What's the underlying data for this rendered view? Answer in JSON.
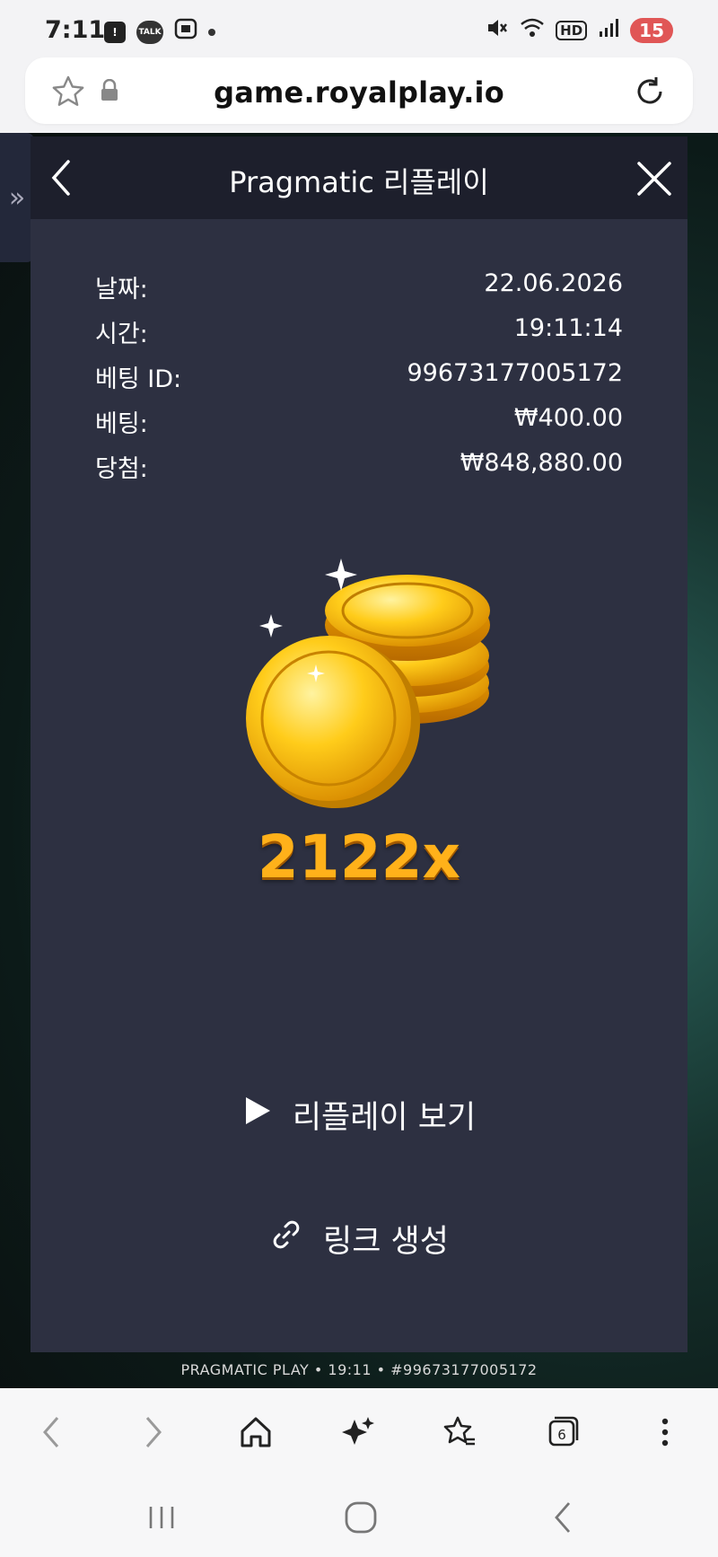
{
  "status_bar": {
    "time": "7:11",
    "battery": "15",
    "icons": [
      "alert-icon",
      "kakaotalk-icon",
      "screenshot-icon",
      "notification-dot-icon",
      "mute-icon",
      "wifi-icon",
      "hd-icon",
      "signal-icon"
    ],
    "talk_label": "TALK",
    "hd_label": "HD"
  },
  "browser": {
    "url": "game.royalplay.io"
  },
  "game": {
    "sidebar_toggle": "»",
    "footer_text": "PRAGMATIC PLAY • 19:11 • #99673177005172"
  },
  "modal": {
    "title": "Pragmatic 리플레이",
    "details": [
      {
        "label": "날짜:",
        "value": "22.06.2026"
      },
      {
        "label": "시간:",
        "value": "19:11:14"
      },
      {
        "label": "베팅 ID:",
        "value": "99673177005172"
      },
      {
        "label": "베팅:",
        "value": "₩400.00"
      },
      {
        "label": "당첨:",
        "value": "₩848,880.00"
      }
    ],
    "multiplier": "2122x",
    "replay_label": "리플레이 보기",
    "link_label": "링크 생성"
  },
  "browser_nav": {
    "tabs_count": "6"
  },
  "colors": {
    "modal_bg": "#2d3041",
    "header_bg": "#1d1f2c",
    "multiplier": "#ffb11a"
  }
}
